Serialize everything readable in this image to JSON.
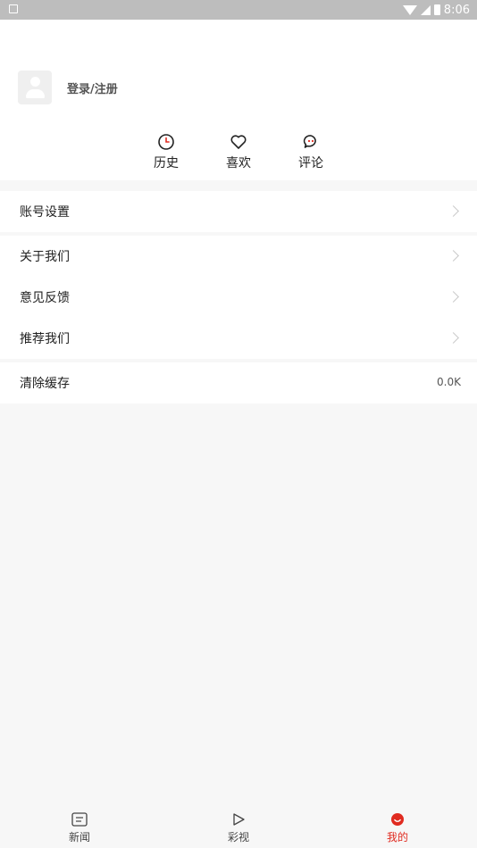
{
  "status_bar": {
    "time": "8:06"
  },
  "profile": {
    "login_label": "登录/注册"
  },
  "quick_actions": [
    {
      "label": "历史",
      "icon": "clock-icon"
    },
    {
      "label": "喜欢",
      "icon": "heart-icon"
    },
    {
      "label": "评论",
      "icon": "comment-icon"
    }
  ],
  "menu": {
    "account_settings": "账号设置",
    "about_us": "关于我们",
    "feedback": "意见反馈",
    "recommend_us": "推荐我们",
    "clear_cache": "清除缓存",
    "cache_size": "0.0K"
  },
  "tabbar": {
    "items": [
      {
        "label": "新闻",
        "icon": "news-icon"
      },
      {
        "label": "彩视",
        "icon": "play-icon"
      },
      {
        "label": "我的",
        "icon": "profile-smile-icon"
      }
    ],
    "active_index": 2,
    "active_color": "#e02b20"
  },
  "colors": {
    "accent": "#e02b20",
    "background": "#f7f7f7"
  }
}
